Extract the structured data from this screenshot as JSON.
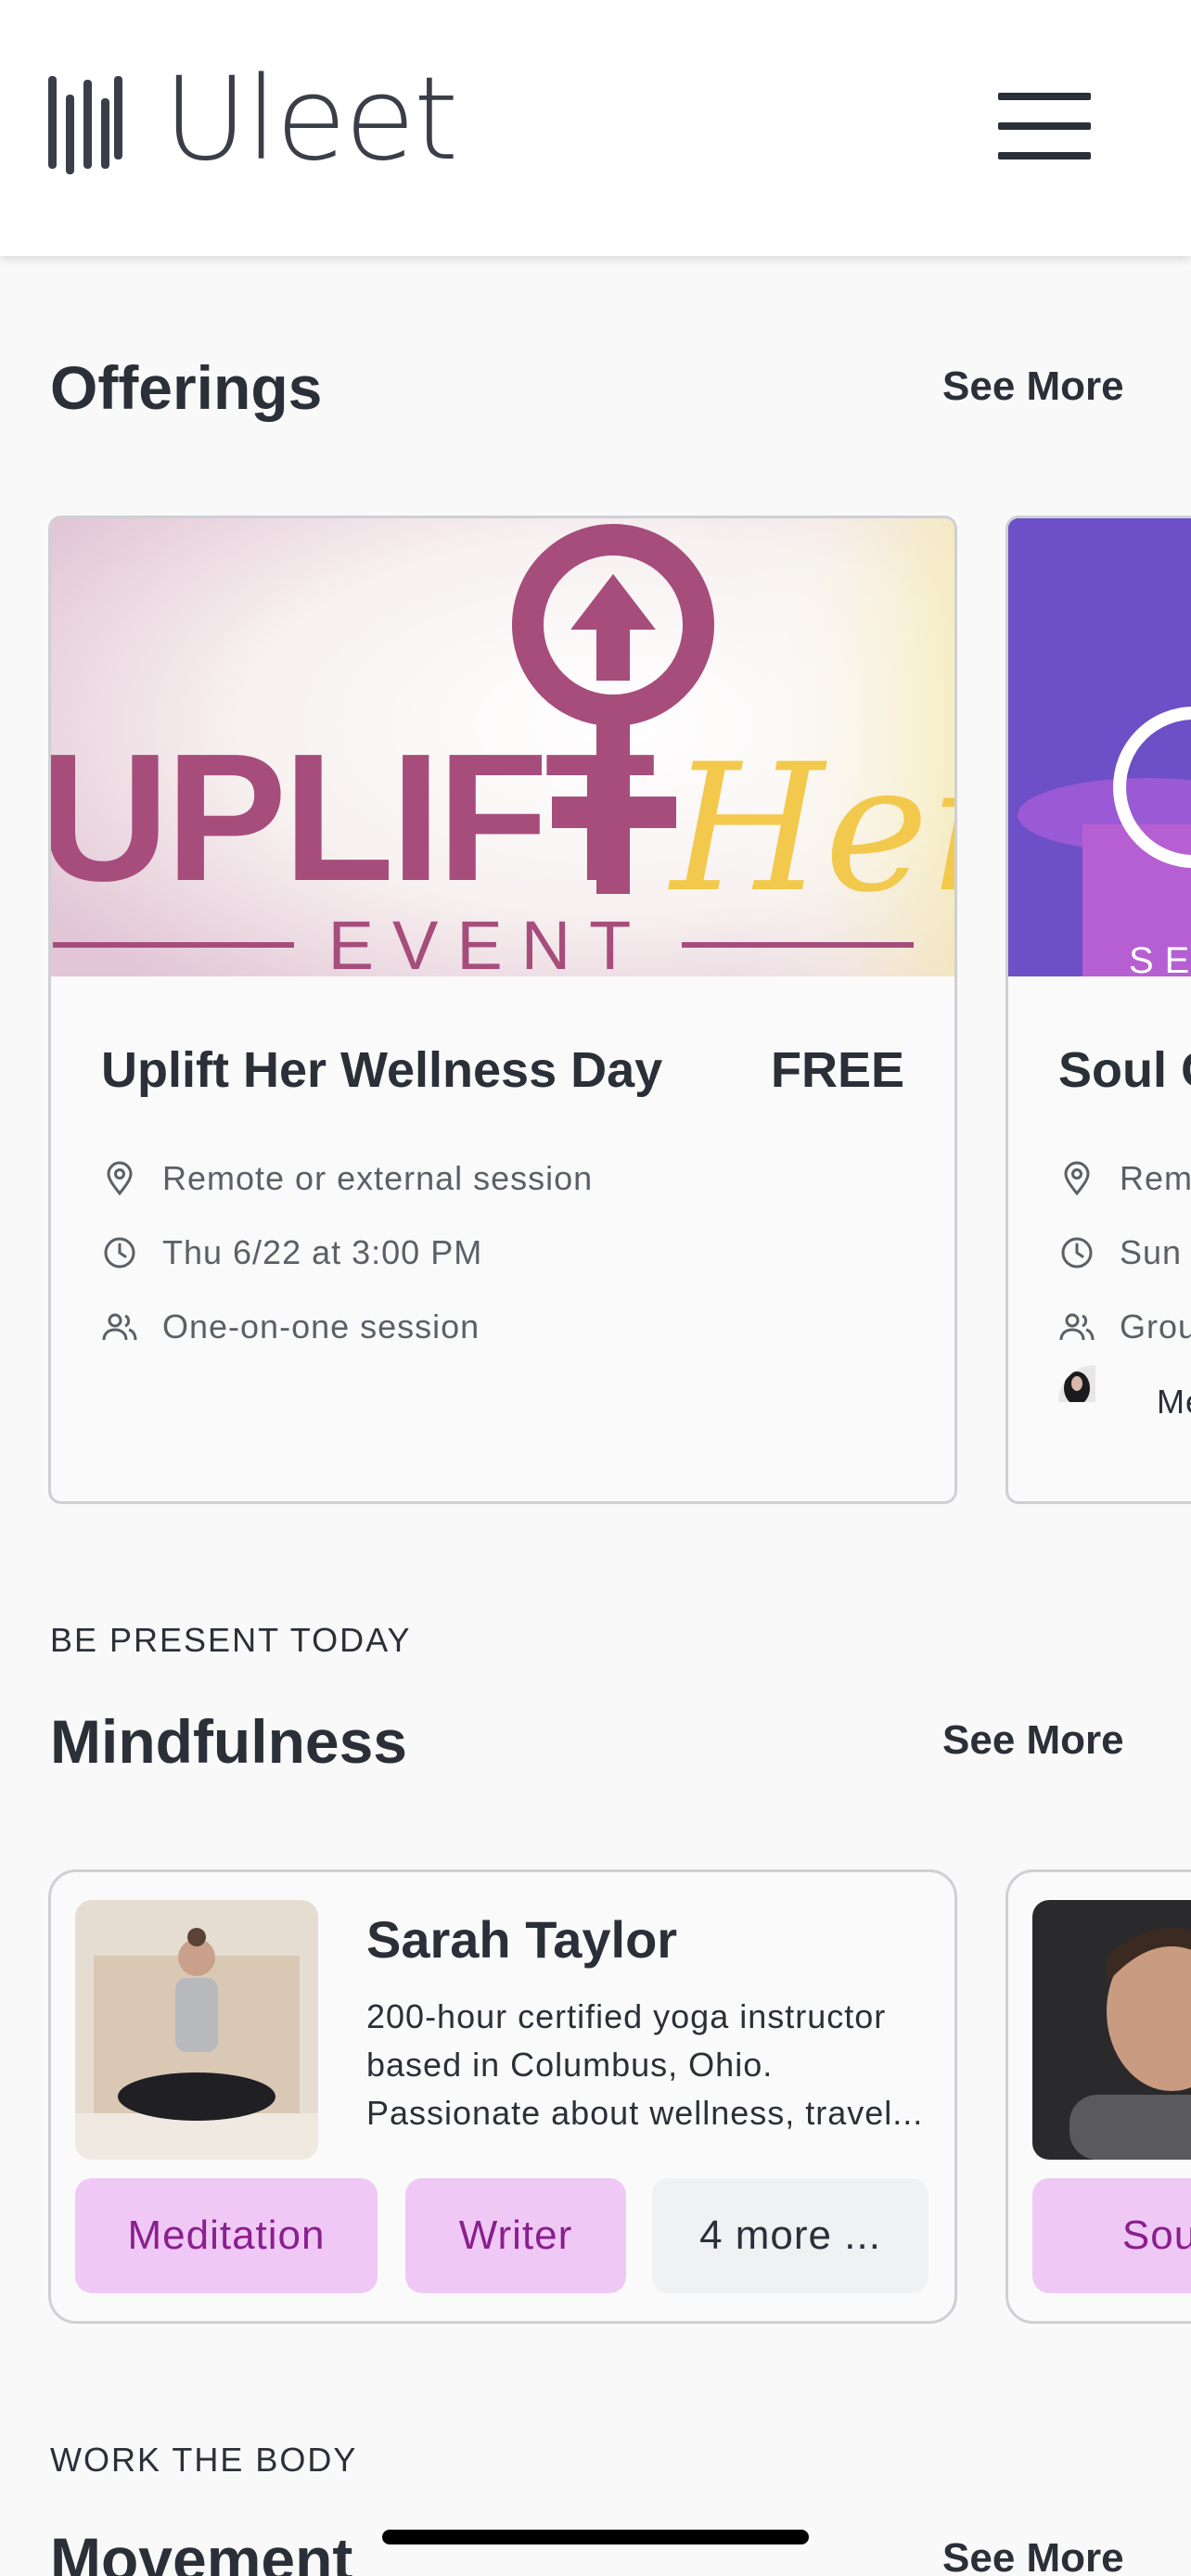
{
  "app": {
    "name": "Uleet",
    "menu_icon": "hamburger-icon"
  },
  "offerings": {
    "title": "Offerings",
    "see_more": "See More",
    "cards": [
      {
        "banner": {
          "word": "UPLIFT",
          "script": "Her",
          "sub": "EVENT",
          "colors": {
            "magenta": "#a64d7c",
            "gold": "#f2c94c"
          }
        },
        "title": "Uplift Her Wellness Day",
        "price": "FREE",
        "location": "Remote or external session",
        "datetime": "Thu 6/22 at 3:00 PM",
        "session_type": "One-on-one session"
      },
      {
        "banner": {
          "sub": "SE",
          "colors": {
            "bg": "#6d4fc7"
          }
        },
        "title": "Soul C",
        "location": "Rem",
        "datetime": "Sun (",
        "session_type": "Grou",
        "host": "Me"
      }
    ]
  },
  "mindfulness": {
    "eyebrow": "BE PRESENT TODAY",
    "title": "Mindfulness",
    "see_more": "See More",
    "people": [
      {
        "name": "Sarah Taylor",
        "bio": "200-hour certified yoga instructor based in Columbus, Ohio. Passionate about wellness, travel...",
        "tags": [
          "Meditation",
          "Writer"
        ],
        "more": "4 more ..."
      },
      {
        "tags": [
          "Sound"
        ]
      }
    ]
  },
  "movement": {
    "eyebrow": "WORK THE BODY",
    "title": "Movement",
    "see_more": "See More"
  },
  "colors": {
    "tag_bg": "#f0c8f6",
    "tag_text": "#8a1f8e",
    "text": "#2b2f38"
  }
}
